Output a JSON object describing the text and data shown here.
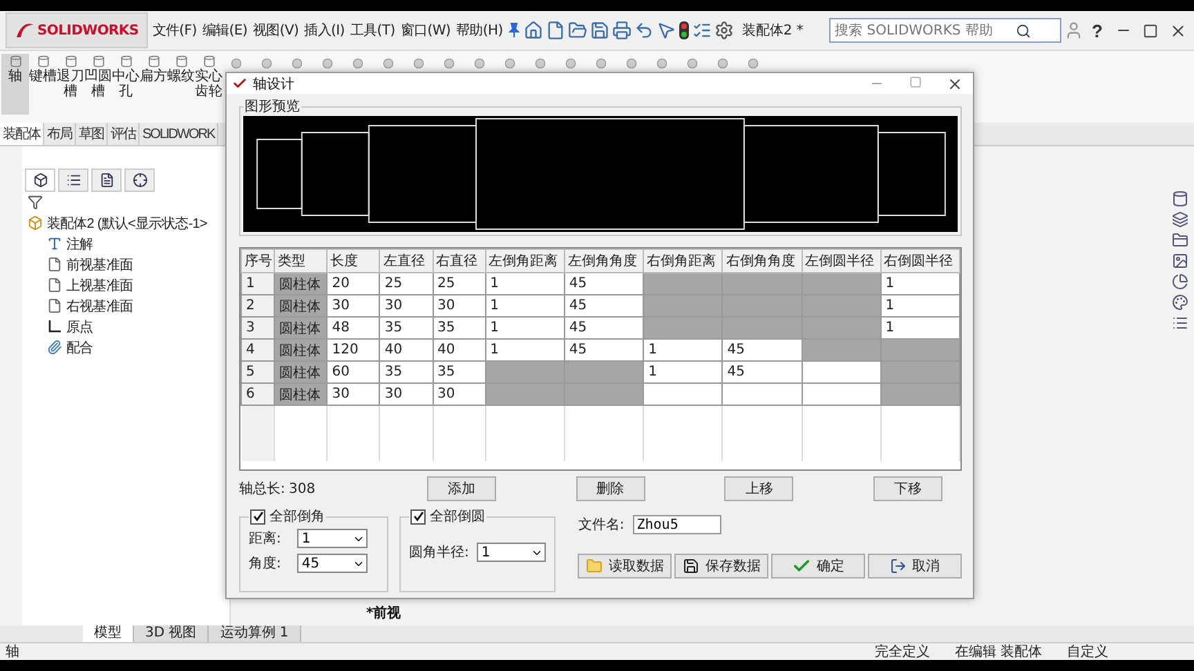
{
  "menu_bar": {
    "logo": "SOLIDWORKS",
    "menu": [
      "文件(F)",
      "编辑(E)",
      "视图(V)",
      "插入(I)",
      "工具(T)",
      "窗口(W)",
      "帮助(H)"
    ],
    "document_title": "装配体2 *",
    "search": {
      "placeholder": "搜索 SOLIDWORKS 帮助"
    },
    "help": "?"
  },
  "command_tools": [
    {
      "label": "轴",
      "selected": true
    },
    {
      "label": "键槽",
      "selected": false
    },
    {
      "label": "退刀槽",
      "selected": false
    },
    {
      "label": "凹圆槽",
      "selected": false
    },
    {
      "label": "中心孔",
      "selected": false
    },
    {
      "label": "扁方",
      "selected": false
    },
    {
      "label": "螺纹",
      "selected": false
    },
    {
      "label": "实心齿轮",
      "selected": false
    }
  ],
  "command_tabs": [
    {
      "label": "装配体",
      "selected": true
    },
    {
      "label": "布局",
      "selected": false
    },
    {
      "label": "草图",
      "selected": false
    },
    {
      "label": "评估",
      "selected": false
    },
    {
      "label": "SOLIDWORK",
      "selected": false
    }
  ],
  "feature_tree": {
    "root": "装配体2 (默认<显示状态-1>",
    "children": [
      {
        "label": "注解",
        "kind": "annotation"
      },
      {
        "label": "前视基准面",
        "kind": "plane"
      },
      {
        "label": "上视基准面",
        "kind": "plane"
      },
      {
        "label": "右视基准面",
        "kind": "plane"
      },
      {
        "label": "原点",
        "kind": "origin"
      },
      {
        "label": "配合",
        "kind": "mate"
      }
    ]
  },
  "view_label": "*前视",
  "bottom_tabs": [
    {
      "label": "模型",
      "selected": true
    },
    {
      "label": "3D 视图",
      "selected": false
    },
    {
      "label": "运动算例 1",
      "selected": false
    }
  ],
  "status_bar": {
    "left": "轴",
    "items": [
      "完全定义",
      "在编辑 装配体",
      "自定义"
    ]
  },
  "dialog": {
    "title": "轴设计",
    "preview_title": "图形预览",
    "table": {
      "columns": [
        "序号",
        "类型",
        "长度",
        "左直径",
        "右直径",
        "左倒角距离",
        "左倒角角度",
        "右倒角距离",
        "右倒角角度",
        "左倒圆半径",
        "右倒圆半径"
      ],
      "rows": [
        {
          "cells": [
            {
              "text": "1",
              "disabled": false
            },
            {
              "text": "圆柱体",
              "disabled": true
            },
            {
              "text": "20",
              "disabled": false
            },
            {
              "text": "25",
              "disabled": false
            },
            {
              "text": "25",
              "disabled": false
            },
            {
              "text": "1",
              "disabled": false
            },
            {
              "text": "45",
              "disabled": false
            },
            {
              "disabled": true
            },
            {
              "disabled": true
            },
            {
              "disabled": true
            },
            {
              "text": "1",
              "disabled": false
            }
          ]
        },
        {
          "cells": [
            {
              "text": "2",
              "disabled": false
            },
            {
              "text": "圆柱体",
              "disabled": true
            },
            {
              "text": "30",
              "disabled": false
            },
            {
              "text": "30",
              "disabled": false
            },
            {
              "text": "30",
              "disabled": false
            },
            {
              "text": "1",
              "disabled": false
            },
            {
              "text": "45",
              "disabled": false
            },
            {
              "disabled": true
            },
            {
              "disabled": true
            },
            {
              "disabled": true
            },
            {
              "text": "1",
              "disabled": false
            }
          ]
        },
        {
          "cells": [
            {
              "text": "3",
              "disabled": false
            },
            {
              "text": "圆柱体",
              "disabled": true
            },
            {
              "text": "48",
              "disabled": false
            },
            {
              "text": "35",
              "disabled": false
            },
            {
              "text": "35",
              "disabled": false
            },
            {
              "text": "1",
              "disabled": false
            },
            {
              "text": "45",
              "disabled": false
            },
            {
              "disabled": true
            },
            {
              "disabled": true
            },
            {
              "disabled": true
            },
            {
              "text": "1",
              "disabled": false
            }
          ]
        },
        {
          "cells": [
            {
              "text": "4",
              "disabled": false
            },
            {
              "text": "圆柱体",
              "disabled": true
            },
            {
              "text": "120",
              "disabled": false
            },
            {
              "text": "40",
              "disabled": false
            },
            {
              "text": "40",
              "disabled": false
            },
            {
              "text": "1",
              "disabled": false
            },
            {
              "text": "45",
              "disabled": false
            },
            {
              "text": "1",
              "disabled": false
            },
            {
              "text": "45",
              "disabled": false
            },
            {
              "disabled": true
            },
            {
              "disabled": true
            }
          ]
        },
        {
          "cells": [
            {
              "text": "5",
              "disabled": false
            },
            {
              "text": "圆柱体",
              "disabled": true
            },
            {
              "text": "60",
              "disabled": false
            },
            {
              "text": "35",
              "disabled": false
            },
            {
              "text": "35",
              "disabled": false
            },
            {
              "disabled": true
            },
            {
              "disabled": true
            },
            {
              "text": "1",
              "disabled": false
            },
            {
              "text": "45",
              "disabled": false
            },
            {
              "disabled": false
            },
            {
              "disabled": true
            }
          ]
        },
        {
          "cells": [
            {
              "text": "6",
              "disabled": false
            },
            {
              "text": "圆柱体",
              "disabled": true
            },
            {
              "text": "30",
              "disabled": false
            },
            {
              "text": "30",
              "disabled": false
            },
            {
              "text": "30",
              "disabled": false
            },
            {
              "disabled": true
            },
            {
              "disabled": true
            },
            {
              "disabled": false
            },
            {
              "disabled": false
            },
            {
              "disabled": false
            },
            {
              "disabled": true
            }
          ]
        }
      ]
    },
    "total_length_label": "轴总长:",
    "total_length": "308",
    "row_buttons": [
      "添加",
      "删除",
      "上移",
      "下移"
    ],
    "chamfer_group": {
      "label": "全部倒角",
      "checked": true,
      "fields": [
        {
          "label": "距离:",
          "value": "1"
        },
        {
          "label": "角度:",
          "value": "45"
        }
      ]
    },
    "fillet_group": {
      "label": "全部倒圆",
      "checked": true,
      "fields": [
        {
          "label": "圆角半径:",
          "value": "1"
        }
      ]
    },
    "file_name": {
      "label": "文件名:",
      "value": "Zhou5"
    },
    "action_buttons": [
      {
        "label": "读取数据",
        "kind": "load"
      },
      {
        "label": "保存数据",
        "kind": "save"
      },
      {
        "label": "确定",
        "kind": "ok"
      },
      {
        "label": "取消",
        "kind": "cancel"
      }
    ]
  }
}
